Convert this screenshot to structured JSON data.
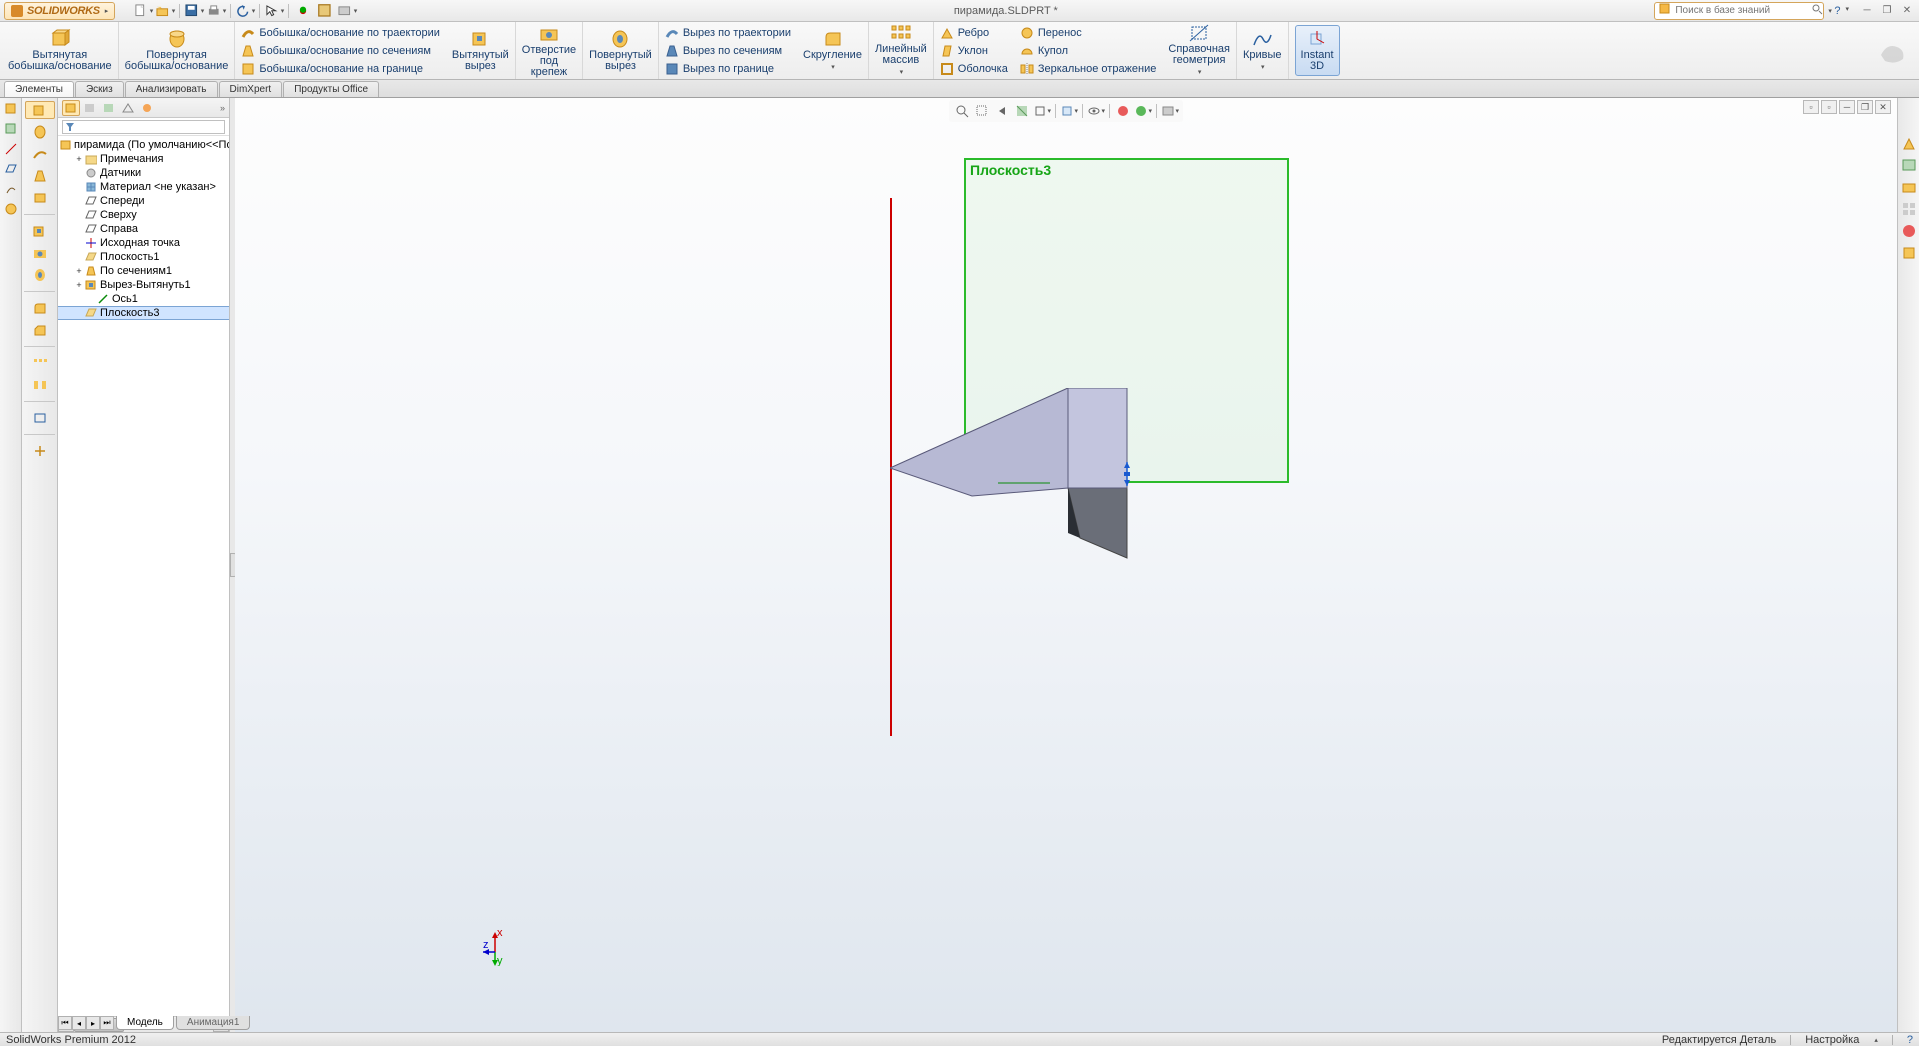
{
  "app": {
    "name": "SOLIDWORKS",
    "title": "пирамида.SLDPRT *"
  },
  "search": {
    "placeholder": "Поиск в базе знаний"
  },
  "ribbon": {
    "extrude_boss": "Вытянутая\nбобышка/основание",
    "revolve_boss": "Повернутая\nбобышка/основание",
    "sweep_boss": "Бобышка/основание по траектории",
    "loft_boss": "Бобышка/основание по сечениям",
    "boundary_boss": "Бобышка/основание на границе",
    "extrude_cut": "Вытянутый\nвырез",
    "hole_wizard": "Отверстие\nпод\nкрепеж",
    "revolve_cut": "Повернутый\nвырез",
    "sweep_cut": "Вырез по траектории",
    "loft_cut": "Вырез по сечениям",
    "boundary_cut": "Вырез по границе",
    "fillet": "Скругление",
    "linear_pattern": "Линейный\nмассив",
    "rib": "Ребро",
    "draft": "Уклон",
    "shell": "Оболочка",
    "wrap": "Перенос",
    "dome": "Купол",
    "mirror": "Зеркальное отражение",
    "ref_geom": "Справочная\nгеометрия",
    "curves": "Кривые",
    "instant3d": "Instant\n3D"
  },
  "tabs": [
    "Элементы",
    "Эскиз",
    "Анализировать",
    "DimXpert",
    "Продукты Office"
  ],
  "active_tab": 0,
  "tree": {
    "root": "пирамида  (По умолчанию<<По умол",
    "items": [
      {
        "label": "Примечания",
        "icon": "folder",
        "expand": "+",
        "indent": 1
      },
      {
        "label": "Датчики",
        "icon": "sensor",
        "indent": 1
      },
      {
        "label": "Материал <не указан>",
        "icon": "material",
        "indent": 1
      },
      {
        "label": "Спереди",
        "icon": "plane",
        "indent": 1
      },
      {
        "label": "Сверху",
        "icon": "plane",
        "indent": 1
      },
      {
        "label": "Справа",
        "icon": "plane",
        "indent": 1
      },
      {
        "label": "Исходная точка",
        "icon": "origin",
        "indent": 1
      },
      {
        "label": "Плоскость1",
        "icon": "plane-y",
        "indent": 1
      },
      {
        "label": "По сечениям1",
        "icon": "loft",
        "expand": "+",
        "indent": 1
      },
      {
        "label": "Вырез-Вытянуть1",
        "icon": "cut",
        "expand": "+",
        "indent": 1
      },
      {
        "label": "Ось1",
        "icon": "axis",
        "indent": 2
      },
      {
        "label": "Плоскость3",
        "icon": "plane-y",
        "indent": 1,
        "selected": true
      }
    ]
  },
  "viewport": {
    "plane_label": "Плоскость3"
  },
  "bottom_tabs": {
    "model": "Модель",
    "anim": "Анимация1"
  },
  "status": {
    "left": "SolidWorks Premium 2012",
    "editing": "Редактируется Деталь",
    "custom": "Настройка"
  },
  "triad": {
    "x": "x",
    "y": "y",
    "z": "z"
  }
}
